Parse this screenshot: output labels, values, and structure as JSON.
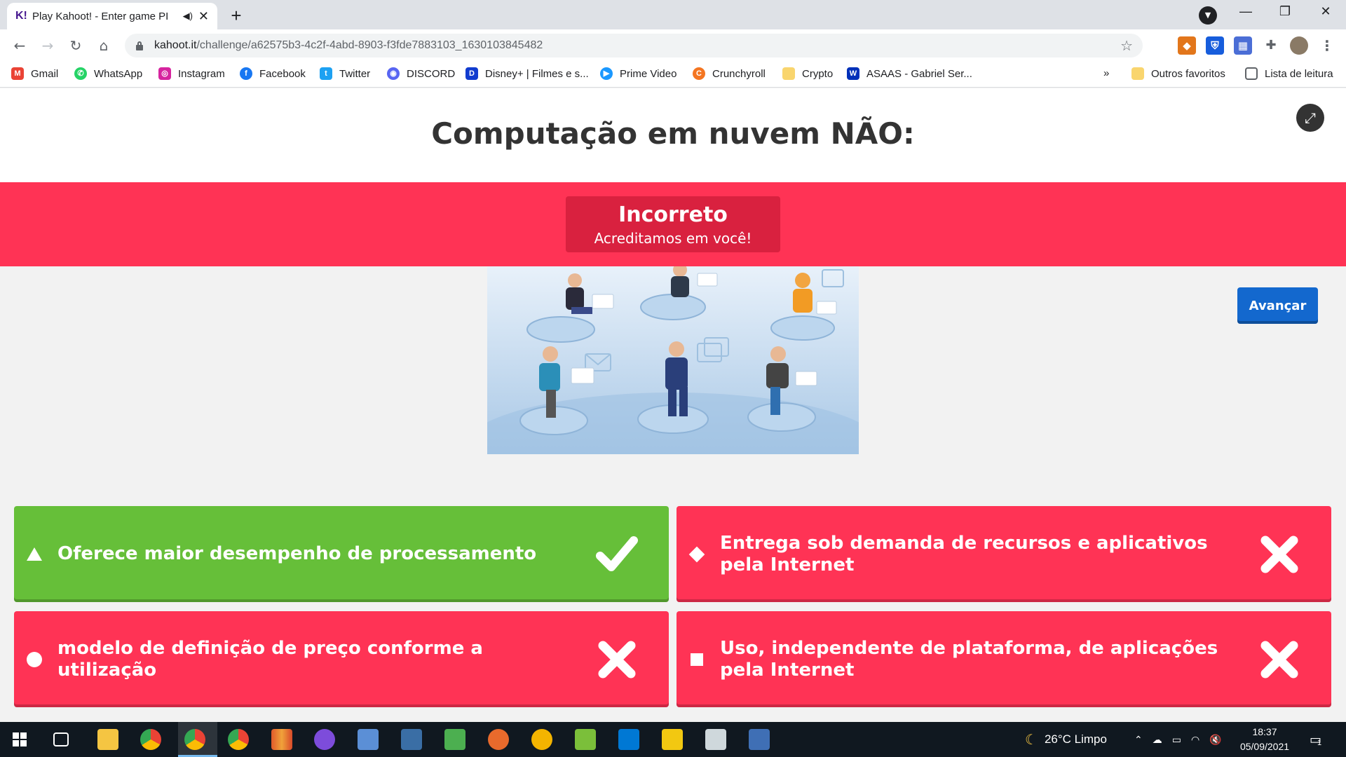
{
  "browser": {
    "tab_title": "Play Kahoot! - Enter game PI",
    "tab_favicon": "K!",
    "url_host": "kahoot.it",
    "url_path": "/challenge/a62575b3-4c2f-4abd-8903-f3fde7883103_1630103845482"
  },
  "bookmarks": [
    {
      "label": "Gmail",
      "icon": "gmail-icon",
      "color": "#ea4335",
      "glyph": "M"
    },
    {
      "label": "WhatsApp",
      "icon": "whatsapp-icon",
      "color": "#25d366",
      "glyph": "✆"
    },
    {
      "label": "Instagram",
      "icon": "instagram-icon",
      "color": "#d6249f",
      "glyph": "◎"
    },
    {
      "label": "Facebook",
      "icon": "facebook-icon",
      "color": "#1877f2",
      "glyph": "f"
    },
    {
      "label": "Twitter",
      "icon": "twitter-icon",
      "color": "#1da1f2",
      "glyph": "t"
    },
    {
      "label": "DISCORD",
      "icon": "discord-icon",
      "color": "#5865f2",
      "glyph": "◉"
    },
    {
      "label": "Disney+ | Filmes e s...",
      "icon": "disney-icon",
      "color": "#113ccf",
      "glyph": "D"
    },
    {
      "label": "Prime Video",
      "icon": "prime-video-icon",
      "color": "#1a98ff",
      "glyph": "▶"
    },
    {
      "label": "Crunchyroll",
      "icon": "crunchyroll-icon",
      "color": "#f47521",
      "glyph": "C"
    },
    {
      "label": "Crypto",
      "icon": "folder-icon",
      "color": "#f9d56e",
      "glyph": ""
    },
    {
      "label": "ASAAS - Gabriel Ser...",
      "icon": "asaas-icon",
      "color": "#0030b9",
      "glyph": "W"
    }
  ],
  "bookmarks_right": {
    "overflow": "»",
    "other": "Outros favoritos",
    "reading_list": "Lista de leitura"
  },
  "kahoot": {
    "question": "Computação em nuvem NÃO:",
    "result_title": "Incorreto",
    "result_subtitle": "Acreditamos em você!",
    "next_button": "Avançar",
    "answers": [
      {
        "shape": "triangle",
        "text": "Oferece maior desempenho de processamento",
        "correct": true,
        "color": "#66bf39"
      },
      {
        "shape": "diamond",
        "text": "Entrega sob demanda de recursos e aplicativos pela Internet",
        "correct": false,
        "color": "#ff3355"
      },
      {
        "shape": "circle",
        "text": "modelo de definição de preço conforme a utilização",
        "correct": false,
        "color": "#ff3355"
      },
      {
        "shape": "square",
        "text": "Uso, independente de plataforma, de aplicações pela Internet",
        "correct": false,
        "color": "#ff3355"
      }
    ]
  },
  "taskbar": {
    "weather": "26°C  Limpo",
    "time": "18:37",
    "date": "05/09/2021",
    "notifications": "1"
  }
}
